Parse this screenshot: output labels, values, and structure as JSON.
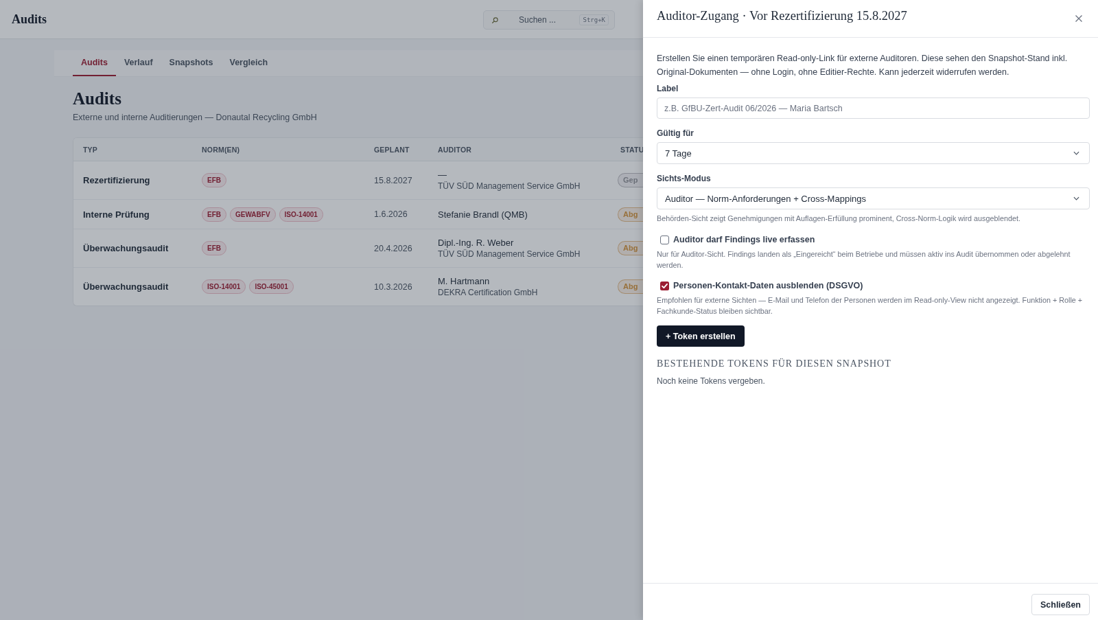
{
  "header": {
    "title": "Audits",
    "search": {
      "placeholder": "Suchen ...",
      "shortcut": "Strg+K"
    }
  },
  "tabs": [
    {
      "label": "Audits",
      "selected": true
    },
    {
      "label": "Verlauf",
      "selected": false
    },
    {
      "label": "Snapshots",
      "selected": false
    },
    {
      "label": "Vergleich",
      "selected": false
    }
  ],
  "page": {
    "title": "Audits",
    "subtitle": "Externe und interne Auditierungen — Donautal Recycling GmbH"
  },
  "table": {
    "columns": [
      "TYP",
      "NORM(EN)",
      "GEPLANT",
      "AUDITOR",
      "STATU"
    ],
    "rows": [
      {
        "type": "Rezertifizierung",
        "norms": [
          "EFB"
        ],
        "planned": "15.8.2027",
        "auditor": {
          "name": "—",
          "org": "TÜV SÜD Management Service GmbH"
        },
        "status": {
          "text": "Gep",
          "color": "#6b7079"
        }
      },
      {
        "type": "Interne Prüfung",
        "norms": [
          "EFB",
          "GEWABFV",
          "ISO-14001"
        ],
        "planned": "1.6.2026",
        "auditor": {
          "name": "Stefanie Brandl (QMB)"
        },
        "status": {
          "text": "Abg",
          "color": "#98703a"
        }
      },
      {
        "type": "Überwachungsaudit",
        "norms": [
          "EFB"
        ],
        "planned": "20.4.2026",
        "auditor": {
          "name": "Dipl.-Ing. R. Weber",
          "org": "TÜV SÜD Management Service GmbH"
        },
        "status": {
          "text": "Abg",
          "color": "#98703a"
        }
      },
      {
        "type": "Überwachungsaudit",
        "norms": [
          "ISO-14001",
          "ISO-45001"
        ],
        "planned": "10.3.2026",
        "auditor": {
          "name": "M. Hartmann",
          "org": "DEKRA Certification GmbH"
        },
        "status": {
          "text": "Abg",
          "color": "#98703a"
        }
      }
    ]
  },
  "drawer": {
    "title": "Auditor-Zugang · Vor Rezertifizierung 15.8.2027",
    "description": "Erstellen Sie einen temporären Read-only-Link für externe Auditoren. Diese sehen den Snapshot-Stand inkl. Original-Dokumenten — ohne Login, ohne Editier-Rechte. Kann jederzeit widerrufen werden.",
    "fields": [
      {
        "kind": "text",
        "label": "Label",
        "placeholder": "z.B. GfBU-Zert-Audit 06/2026 — Maria Bartsch"
      },
      {
        "kind": "select",
        "label": "Gültig für",
        "value": "7 Tage"
      },
      {
        "kind": "select",
        "label": "Sichts-Modus",
        "value": "Auditor — Norm-Anforderungen + Cross-Mappings",
        "hint": "Behörden-Sicht zeigt Genehmigungen mit Auflagen-Erfüllung prominent, Cross-Norm-Logik wird ausgeblendet."
      }
    ],
    "options": [
      {
        "label": "Auditor darf Findings live erfassen",
        "checked": false,
        "hint": "Nur für Auditor-Sicht. Findings landen als „Eingereicht“ beim Betriebe und müssen aktiv ins Audit übernommen oder abgelehnt werden."
      },
      {
        "label": "Personen-Kontakt-Daten ausblenden (DSGVO)",
        "checked": true,
        "hint": "Empfohlen für externe Sichten — E-Mail und Telefon der Personen werden im Read-only-View nicht angezeigt. Funktion + Rolle + Fachkunde-Status bleiben sichtbar."
      }
    ],
    "create_button": "+ Token erstellen",
    "tokens": {
      "heading": "BESTEHENDE TOKENS FÜR DIESEN SNAPSHOT",
      "empty_text": "Noch keine Tokens vergeben."
    },
    "close_button": "Schließen"
  }
}
